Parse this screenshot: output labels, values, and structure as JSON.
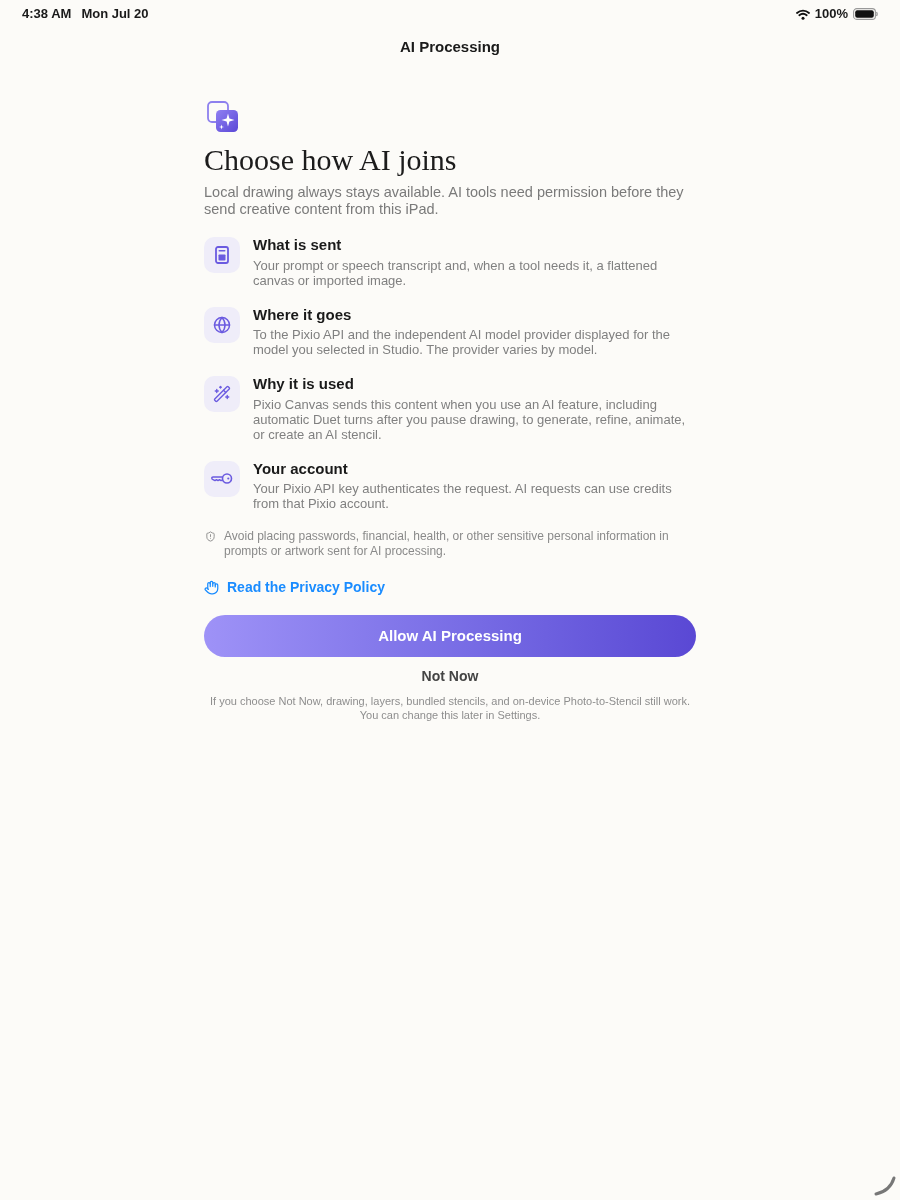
{
  "status_bar": {
    "time": "4:38 AM",
    "date": "Mon Jul 20",
    "battery": "100%"
  },
  "nav": {
    "title": "AI Processing"
  },
  "header": {
    "heading": "Choose how AI joins",
    "subtitle": "Local drawing always stays available. AI tools need permission before they send creative content from this iPad."
  },
  "items": [
    {
      "kind": "document",
      "title": "What is sent",
      "description": "Your prompt or speech transcript and, when a tool needs it, a flattened canvas or imported image."
    },
    {
      "kind": "globe",
      "title": "Where it goes",
      "description": "To the Pixio API and the independent AI model provider displayed for the model you selected in Studio. The provider varies by model."
    },
    {
      "kind": "wand",
      "title": "Why it is used",
      "description": "Pixio Canvas sends this content when you use an AI feature, including automatic Duet turns after you pause drawing, to generate, refine, animate, or create an AI stencil."
    },
    {
      "kind": "key",
      "title": "Your account",
      "description": "Your Pixio API key authenticates the request. AI requests can use credits from that Pixio account."
    }
  ],
  "note": "Avoid placing passwords, financial, health, or other sensitive personal information in prompts or artwork sent for AI processing.",
  "privacy_link": "Read the Privacy Policy",
  "primary_button": "Allow AI Processing",
  "secondary_button": "Not Now",
  "footer": [
    "If you choose Not Now, drawing, layers, bundled stencils, and on-device Photo-to-Stencil still work.",
    "You can change this later in Settings."
  ]
}
